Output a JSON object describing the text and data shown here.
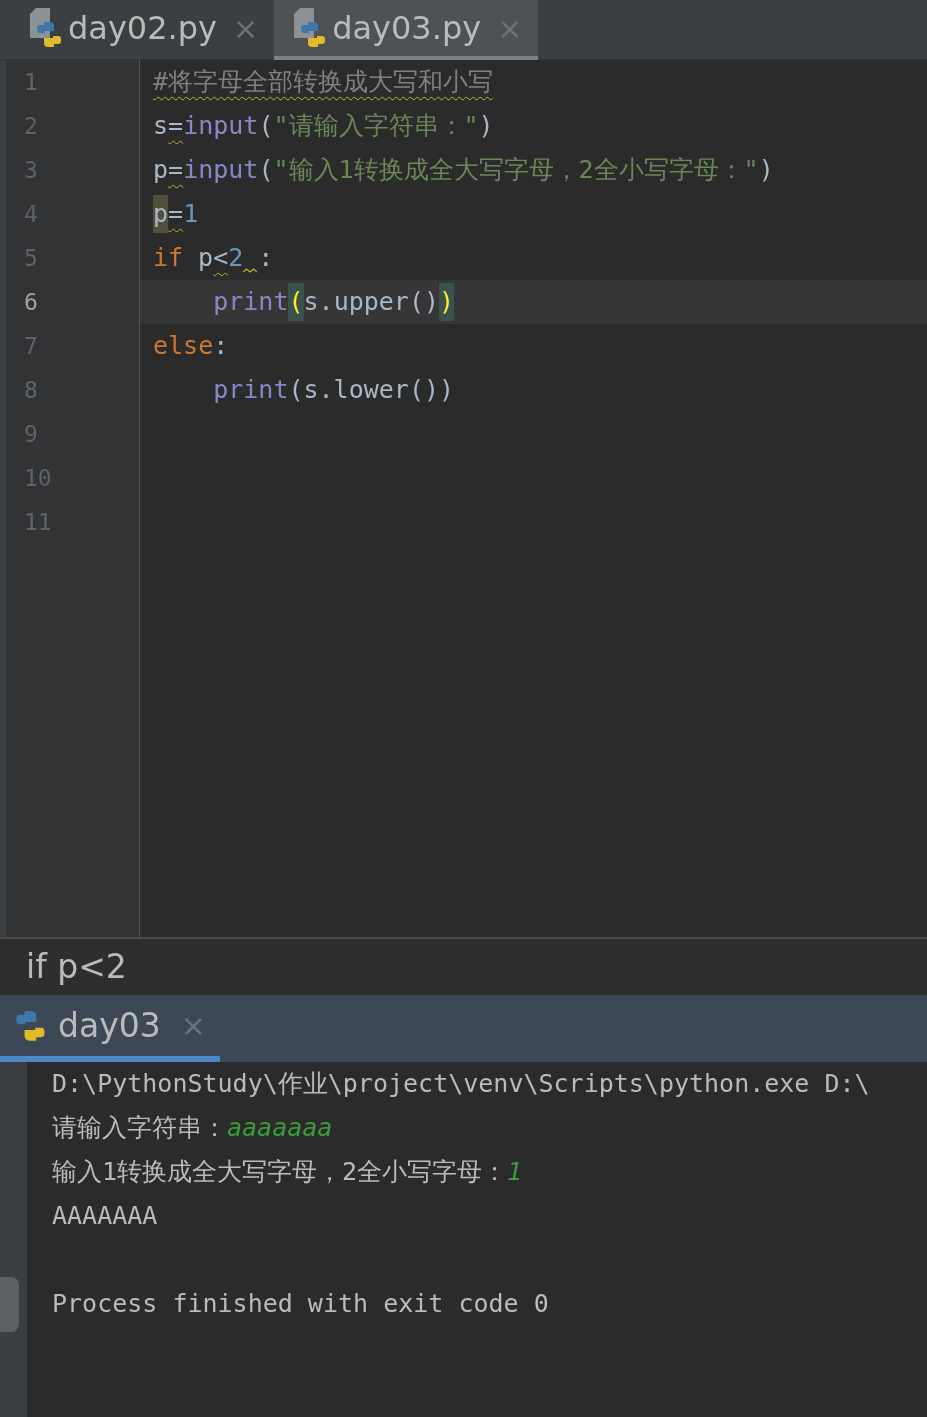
{
  "editor_tabs": [
    {
      "label": "day02.py",
      "close": "×",
      "selected": false
    },
    {
      "label": "day03.py",
      "close": "×",
      "selected": true
    }
  ],
  "code_lines": [
    {
      "number": "1",
      "current": false,
      "tokens": [
        {
          "kind": "comment",
          "text": "#将字母全部转换成大写和小写",
          "warn": true
        }
      ]
    },
    {
      "number": "2",
      "current": false,
      "tokens": [
        {
          "kind": "name",
          "text": "s"
        },
        {
          "kind": "punct",
          "text": "=",
          "warn": true
        },
        {
          "kind": "builtin",
          "text": "input"
        },
        {
          "kind": "punct",
          "text": "("
        },
        {
          "kind": "string",
          "text": "\"请输入字符串：\""
        },
        {
          "kind": "punct",
          "text": ")"
        }
      ]
    },
    {
      "number": "3",
      "current": false,
      "tokens": [
        {
          "kind": "name",
          "text": "p"
        },
        {
          "kind": "punct",
          "text": "=",
          "warn": true
        },
        {
          "kind": "builtin",
          "text": "input"
        },
        {
          "kind": "punct",
          "text": "("
        },
        {
          "kind": "string",
          "text": "\"输入1转换成全大写字母，2全小写字母：\""
        },
        {
          "kind": "punct",
          "text": ")"
        }
      ]
    },
    {
      "number": "4",
      "current": false,
      "tokens": [
        {
          "kind": "name",
          "text": "p",
          "highlighted": true
        },
        {
          "kind": "punct",
          "text": "=",
          "warn": true
        },
        {
          "kind": "number",
          "text": "1"
        }
      ]
    },
    {
      "number": "5",
      "current": false,
      "tokens": [
        {
          "kind": "keyword",
          "text": "if"
        },
        {
          "kind": "name",
          "text": "p",
          "space_before": true
        },
        {
          "kind": "punct",
          "text": "<",
          "warn": true
        },
        {
          "kind": "number",
          "text": "2"
        },
        {
          "kind": "punct",
          "text": ":",
          "space_before": true,
          "space_warn": true
        }
      ]
    },
    {
      "number": "6",
      "current": true,
      "tokens": [
        {
          "kind": "builtin",
          "text": "    print"
        },
        {
          "kind": "punct",
          "text": "(",
          "matched": true
        },
        {
          "kind": "name",
          "text": "s.upper()"
        },
        {
          "kind": "punct",
          "text": ")",
          "matched": true
        }
      ]
    },
    {
      "number": "7",
      "current": false,
      "tokens": [
        {
          "kind": "keyword",
          "text": "else"
        },
        {
          "kind": "punct",
          "text": ":"
        }
      ]
    },
    {
      "number": "8",
      "current": false,
      "tokens": [
        {
          "kind": "builtin",
          "text": "    print"
        },
        {
          "kind": "name",
          "text": "(s.lower())"
        }
      ]
    },
    {
      "number": "9",
      "current": false
    },
    {
      "number": "10",
      "current": false
    },
    {
      "number": "11",
      "current": false
    }
  ],
  "breadcrumb": "if p<2",
  "run_tab": {
    "label": "day03",
    "close": "×",
    "selected": true
  },
  "console_lines": [
    {
      "segments": [
        {
          "kind": "output",
          "text": "D:\\PythonStudy\\作业\\project\\venv\\Scripts\\python.exe D:\\"
        }
      ]
    },
    {
      "segments": [
        {
          "kind": "output",
          "text": "请输入字符串："
        },
        {
          "kind": "input",
          "text": "aaaaaaa"
        }
      ]
    },
    {
      "segments": [
        {
          "kind": "output",
          "text": "输入1转换成全大写字母，2全小写字母："
        },
        {
          "kind": "input",
          "text": "1"
        }
      ]
    },
    {
      "segments": [
        {
          "kind": "output",
          "text": "AAAAAAA"
        }
      ]
    },
    {
      "kind": "exit_status",
      "segments": [
        {
          "kind": "output",
          "text": "Process finished with exit code 0"
        }
      ]
    }
  ]
}
